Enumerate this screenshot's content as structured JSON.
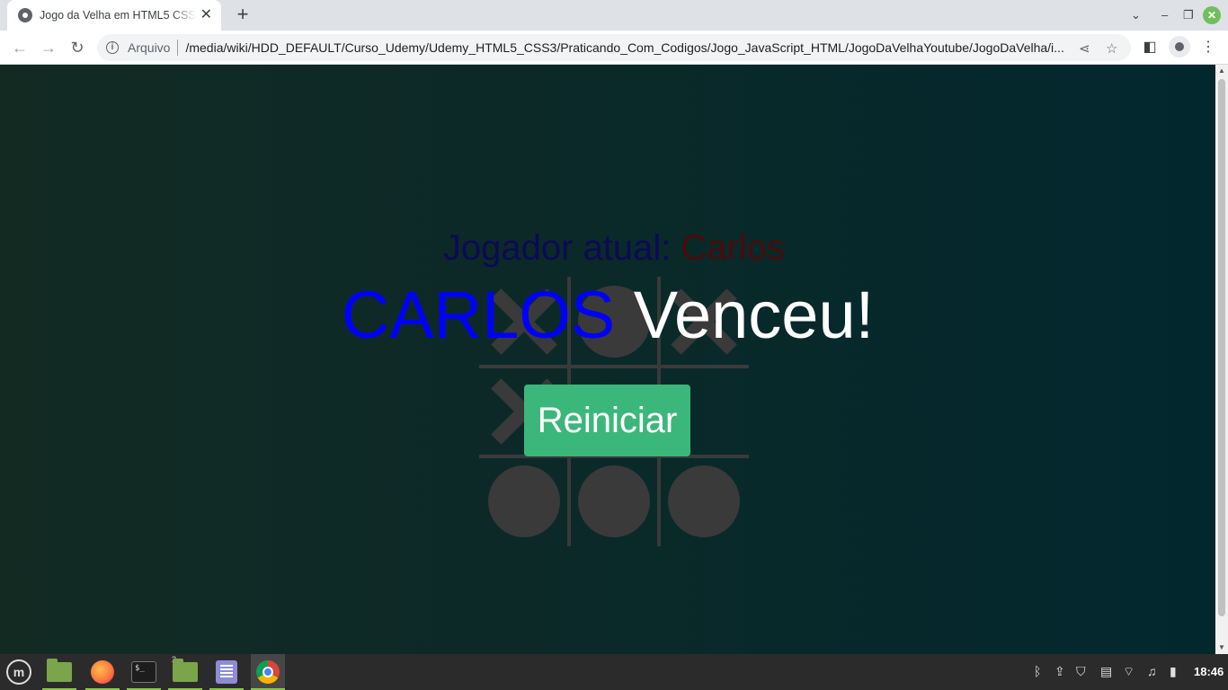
{
  "browser": {
    "tab_title": "Jogo da Velha em HTML5 CSS",
    "new_tab": "+",
    "url_scheme": "Arquivo",
    "url": "/media/wiki/HDD_DEFAULT/Curso_Udemy/Udemy_HTML5_CSS3/Praticando_Com_Codigos/Jogo_JavaScript_HTML/JogoDaVelhaYoutube/JogoDaVelha/i..."
  },
  "game": {
    "current_player_label": "Jogador atual: ",
    "current_player_name": "Carlos",
    "winner_name": "CARLOS",
    "winner_suffix": " Venceu!",
    "restart_label": "Reiniciar",
    "board": [
      "X",
      "O",
      "X",
      "X",
      "",
      "",
      "O",
      "O",
      "O"
    ],
    "colors": {
      "background_left": "#132a23",
      "background_right": "#02282e",
      "board_marks": "#3a3a3a",
      "winner_name": "#0000ff",
      "restart_button": "#3cb77b",
      "current_player_label": "#0c0a56",
      "current_player_name": "#4a0b0b"
    }
  },
  "taskbar": {
    "apps": [
      "menu-icon",
      "files-icon",
      "firefox-icon",
      "terminal-icon",
      "files-icon",
      "text-editor-icon",
      "chrome-icon"
    ],
    "files_badge": "2",
    "terminal_prompt": "$_",
    "clock": "18:46"
  }
}
